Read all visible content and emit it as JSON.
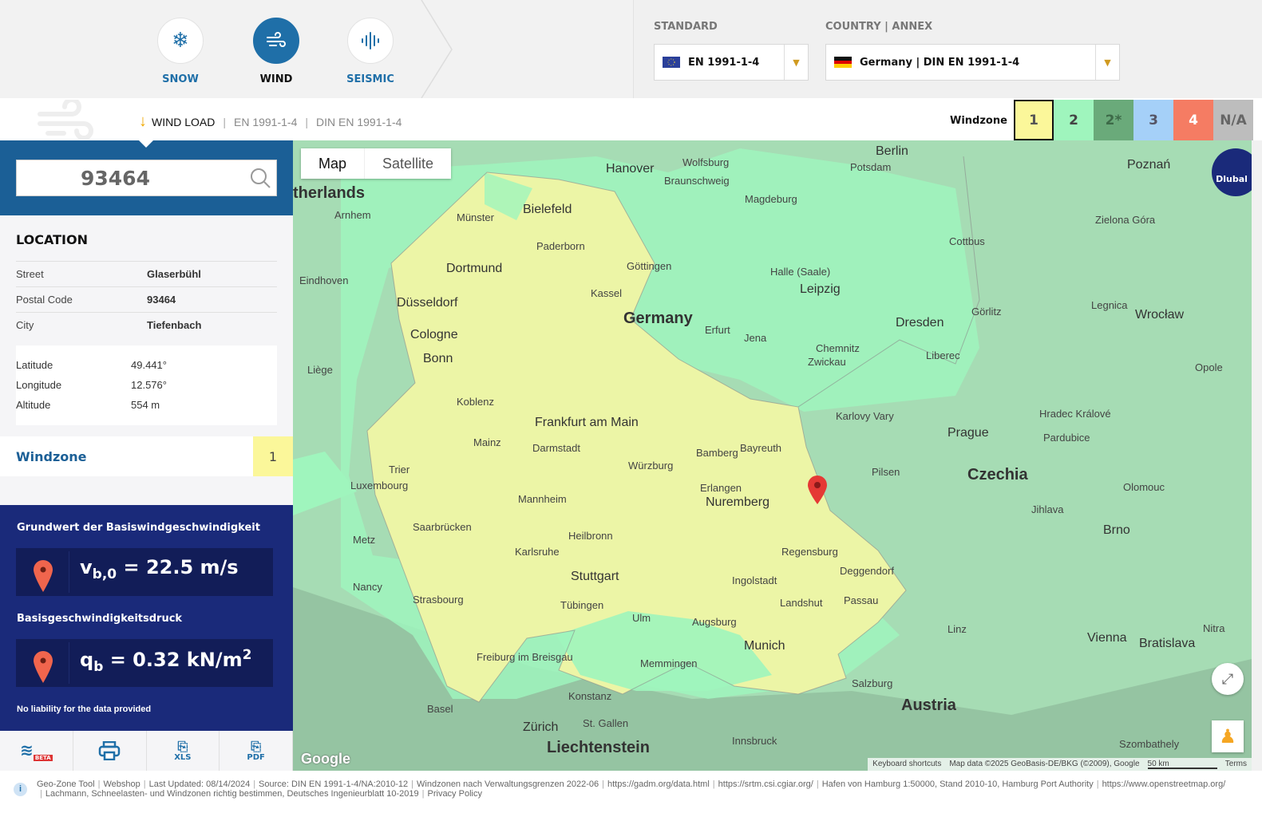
{
  "loads": [
    {
      "label": "SNOW",
      "icon": "snowflake-icon",
      "glyph": "❄"
    },
    {
      "label": "WIND",
      "icon": "wind-icon",
      "glyph": "༄"
    },
    {
      "label": "SEISMIC",
      "icon": "seismic-icon",
      "glyph": "ılıl"
    }
  ],
  "standard": {
    "label": "STANDARD",
    "value": "EN 1991-1-4"
  },
  "country": {
    "label": "COUNTRY | ANNEX",
    "value": "Germany | DIN EN 1991-1-4"
  },
  "breadcrumb": {
    "title": "WIND LOAD",
    "items": [
      "EN 1991-1-4",
      "DIN EN 1991-1-4"
    ]
  },
  "windzone_legend": {
    "label": "Windzone",
    "zones": [
      {
        "label": "1",
        "color": "#fbf79a",
        "text": "#555"
      },
      {
        "label": "2",
        "color": "#9ff5bd",
        "text": "#444"
      },
      {
        "label": "2*",
        "color": "#6aaa7a",
        "text": "#3d6a48"
      },
      {
        "label": "3",
        "color": "#a5d0f8",
        "text": "#556"
      },
      {
        "label": "4",
        "color": "#f57c63",
        "text": "#fff"
      },
      {
        "label": "N/A",
        "color": "#bdbdbd",
        "text": "#666"
      }
    ],
    "selected": "1"
  },
  "search": {
    "value": "93464"
  },
  "location": {
    "title": "LOCATION",
    "rows": [
      {
        "k": "Street",
        "v": "Glaserbühl"
      },
      {
        "k": "Postal Code",
        "v": "93464"
      },
      {
        "k": "City",
        "v": "Tiefenbach"
      }
    ],
    "coords": [
      {
        "k": "Latitude",
        "v": "49.441°"
      },
      {
        "k": "Longitude",
        "v": "12.576°"
      },
      {
        "k": "Altitude",
        "v": "554 m"
      }
    ]
  },
  "windzone": {
    "label": "Windzone",
    "value": "1"
  },
  "results": {
    "h1": "Grundwert der Basiswindgeschwindigkeit",
    "v1": "v",
    "v1sub": "b,0",
    "v1rest": " = 22.5 m/s",
    "h2": "Basisgeschwindigkeitsdruck",
    "v2": "q",
    "v2sub": "b",
    "v2rest": " = 0.32 kN/m",
    "v2sup": "2",
    "note": "No liability for the data provided"
  },
  "tools": [
    {
      "icon": "wind-beta-icon",
      "label": "BETA"
    },
    {
      "icon": "print-icon",
      "label": ""
    },
    {
      "icon": "xls-file-icon",
      "label": "XLS"
    },
    {
      "icon": "pdf-file-icon",
      "label": "PDF"
    }
  ],
  "map": {
    "tabs": [
      "Map",
      "Satellite"
    ],
    "active_tab": "Map",
    "logo": "Dlubal",
    "google": "Google",
    "attribution": [
      "Keyboard shortcuts",
      "Map data ©2025 GeoBasis-DE/BKG (©2009), Google",
      "50 km",
      "Terms"
    ],
    "labels": [
      {
        "t": "Berlin",
        "c": "mid"
      },
      {
        "t": "Hanover",
        "c": "mid"
      },
      {
        "t": "Germany",
        "c": "big"
      },
      {
        "t": "Czechia",
        "c": "big"
      },
      {
        "t": "Austria",
        "c": "big"
      },
      {
        "t": "Liechtenstein",
        "c": "big"
      },
      {
        "t": "therlands",
        "c": "big"
      },
      {
        "t": "Bielefeld",
        "c": "mid"
      },
      {
        "t": "Dortmund",
        "c": "mid"
      },
      {
        "t": "Düsseldorf",
        "c": "mid"
      },
      {
        "t": "Cologne",
        "c": "mid"
      },
      {
        "t": "Bonn",
        "c": "mid"
      },
      {
        "t": "Frankfurt am Main",
        "c": "mid"
      },
      {
        "t": "Leipzig",
        "c": "mid"
      },
      {
        "t": "Dresden",
        "c": "mid"
      },
      {
        "t": "Prague",
        "c": "mid"
      },
      {
        "t": "Nuremberg",
        "c": "mid"
      },
      {
        "t": "Stuttgart",
        "c": "mid"
      },
      {
        "t": "Munich",
        "c": "mid"
      },
      {
        "t": "Vienna",
        "c": "mid"
      },
      {
        "t": "Bratislava",
        "c": "mid"
      },
      {
        "t": "Brno",
        "c": "mid"
      },
      {
        "t": "Wrocław",
        "c": "mid"
      },
      {
        "t": "Poznań",
        "c": "mid"
      },
      {
        "t": "Zürich",
        "c": "mid"
      },
      {
        "t": "Magdeburg",
        "c": ""
      },
      {
        "t": "Potsdam",
        "c": ""
      },
      {
        "t": "Halle (Saale)",
        "c": ""
      },
      {
        "t": "Kassel",
        "c": ""
      },
      {
        "t": "Erfurt",
        "c": ""
      },
      {
        "t": "Jena",
        "c": ""
      },
      {
        "t": "Chemnitz",
        "c": ""
      },
      {
        "t": "Würzburg",
        "c": ""
      },
      {
        "t": "Bamberg",
        "c": ""
      },
      {
        "t": "Regensburg",
        "c": ""
      },
      {
        "t": "Ingolstadt",
        "c": ""
      },
      {
        "t": "Augsburg",
        "c": ""
      },
      {
        "t": "Mannheim",
        "c": ""
      },
      {
        "t": "Karlsruhe",
        "c": ""
      },
      {
        "t": "Saarbrücken",
        "c": ""
      },
      {
        "t": "Strasbourg",
        "c": ""
      },
      {
        "t": "Salzburg",
        "c": ""
      },
      {
        "t": "Linz",
        "c": ""
      },
      {
        "t": "Pilsen",
        "c": ""
      },
      {
        "t": "Innsbruck",
        "c": ""
      },
      {
        "t": "Basel",
        "c": ""
      },
      {
        "t": "Luxembourg",
        "c": ""
      },
      {
        "t": "Metz",
        "c": ""
      },
      {
        "t": "Liège",
        "c": ""
      },
      {
        "t": "Eindhoven",
        "c": ""
      },
      {
        "t": "Arnhem",
        "c": ""
      },
      {
        "t": "Münster",
        "c": ""
      },
      {
        "t": "Paderborn",
        "c": ""
      },
      {
        "t": "Göttingen",
        "c": ""
      },
      {
        "t": "Wolfsburg",
        "c": ""
      },
      {
        "t": "Braunschweig",
        "c": ""
      },
      {
        "t": "Cottbus",
        "c": ""
      },
      {
        "t": "Görlitz",
        "c": ""
      },
      {
        "t": "Liberec",
        "c": ""
      },
      {
        "t": "Olomouc",
        "c": ""
      },
      {
        "t": "Jihlava",
        "c": ""
      },
      {
        "t": "Passau",
        "c": ""
      },
      {
        "t": "Deggendorf",
        "c": ""
      },
      {
        "t": "Landshut",
        "c": ""
      },
      {
        "t": "Ulm",
        "c": ""
      },
      {
        "t": "Memmingen",
        "c": ""
      },
      {
        "t": "Konstanz",
        "c": ""
      },
      {
        "t": "St. Gallen",
        "c": ""
      },
      {
        "t": "Freiburg im Breisgau",
        "c": ""
      },
      {
        "t": "Heilbronn",
        "c": ""
      },
      {
        "t": "Tübingen",
        "c": ""
      },
      {
        "t": "Darmstadt",
        "c": ""
      },
      {
        "t": "Mainz",
        "c": ""
      },
      {
        "t": "Koblenz",
        "c": ""
      },
      {
        "t": "Trier",
        "c": ""
      },
      {
        "t": "Zwickau",
        "c": ""
      },
      {
        "t": "Bayreuth",
        "c": ""
      },
      {
        "t": "Erlangen",
        "c": ""
      },
      {
        "t": "Karlovy Vary",
        "c": ""
      },
      {
        "t": "Hradec Králové",
        "c": ""
      },
      {
        "t": "Pardubice",
        "c": ""
      },
      {
        "t": "Zielona Góra",
        "c": ""
      },
      {
        "t": "Legnica",
        "c": ""
      },
      {
        "t": "Opole",
        "c": ""
      },
      {
        "t": "Nitra",
        "c": ""
      },
      {
        "t": "Szombathely",
        "c": ""
      },
      {
        "t": "Nancy",
        "c": ""
      }
    ]
  },
  "footer": {
    "line1": [
      "Geo-Zone Tool",
      "Webshop",
      "Last Updated: 08/14/2024",
      "Source: DIN EN 1991-1-4/NA:2010-12",
      "Windzonen nach Verwaltungsgrenzen 2022-06",
      "https://gadm.org/data.html",
      "https://srtm.csi.cgiar.org/",
      "Hafen von Hamburg 1:50000, Stand 2010-10, Hamburg Port Authority",
      "https://www.openstreetmap.org/"
    ],
    "line2": [
      "Lachmann, Schneelasten- und Windzonen richtig bestimmen, Deutsches Ingenieurblatt 10-2019",
      "Privacy Policy"
    ]
  }
}
